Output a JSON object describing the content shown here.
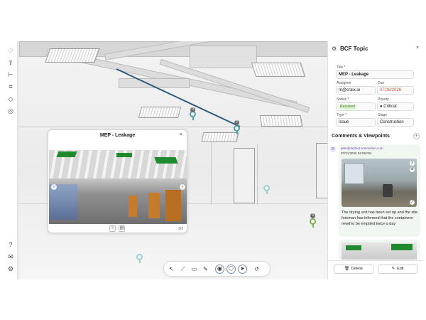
{
  "viewport": {
    "markers": [
      {
        "name": "issue-marker-1",
        "badge": "0"
      },
      {
        "name": "issue-marker-2",
        "badge": "2"
      },
      {
        "name": "issue-marker-3",
        "badge": "3"
      }
    ]
  },
  "left_toolbar": {
    "logo": "◌",
    "tools": [
      {
        "name": "upload-icon",
        "glyph": "⇪"
      },
      {
        "name": "hierarchy-icon",
        "glyph": "⊢"
      },
      {
        "name": "layers-icon",
        "glyph": "≡"
      },
      {
        "name": "shapes-icon",
        "glyph": "◇"
      },
      {
        "name": "target-icon",
        "glyph": "◎"
      },
      {
        "name": "help-icon",
        "glyph": "?"
      },
      {
        "name": "mail-icon",
        "glyph": "✉"
      },
      {
        "name": "settings-icon",
        "glyph": "⚙"
      }
    ]
  },
  "viewpoint_popup": {
    "title": "MEP - Leakage",
    "close": "×",
    "prev": "‹",
    "next": "›",
    "page": "3/3",
    "footer_icons": [
      "⇩",
      "▤"
    ]
  },
  "bottom_toolbar": {
    "tools": [
      {
        "name": "select-icon",
        "glyph": "↖"
      },
      {
        "name": "measure-icon",
        "glyph": "⟋"
      },
      {
        "name": "section-icon",
        "glyph": "▭"
      },
      {
        "name": "markup-icon",
        "glyph": "✎"
      },
      {
        "name": "camera-icon",
        "glyph": "◉"
      },
      {
        "name": "cube-icon",
        "glyph": "⬡"
      },
      {
        "name": "navigate-icon",
        "glyph": "➤"
      },
      {
        "name": "reset-icon",
        "glyph": "↺"
      }
    ]
  },
  "bcf_panel": {
    "title": "BCF Topic",
    "gear": "⚙",
    "close": "×",
    "fields": {
      "title_label": "Title *",
      "title_value": "MEP - Leakage",
      "assignee_label": "Assignee",
      "assignee_value": "m@craix.io",
      "due_label": "Due",
      "due_value": "07/16/2026",
      "status_label": "Status *",
      "status_value": "Resolved",
      "priority_label": "Priority",
      "priority_value": "● Critical",
      "type_label": "Type *",
      "type_value": "Issue",
      "stage_label": "Stage",
      "stage_value": "Construction"
    },
    "comments_heading": "Comments & Viewpoints",
    "add_comment": "+",
    "comment": {
      "avatar": "P",
      "email": "pete@dryfoot-restoration.com",
      "date": "07/21/2026 04:08 PM",
      "text": "The drying unit has been set up and the site foreman has informed that the containers need to be emptied twice a day"
    },
    "delete_label": "Delete",
    "edit_label": "Edit",
    "delete_icon": "🗑",
    "edit_icon": "✎"
  },
  "colors": {
    "accent": "#2a6f8f",
    "resolved_bg": "#dff3d2",
    "resolved_text": "#3f7b25",
    "due_text": "#c2573e",
    "email_text": "#7a3fbf",
    "marker_green": "#7fb04a"
  }
}
